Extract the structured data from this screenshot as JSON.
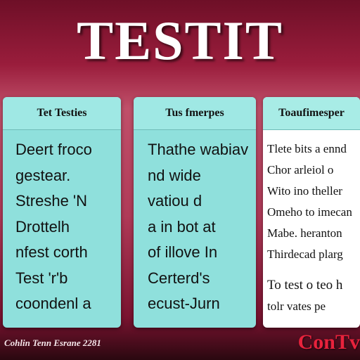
{
  "title": "TESTIT",
  "cards": [
    {
      "header": "Tet Testies",
      "lines": [
        "Deert froco",
        "gestear.",
        "Streshe 'N",
        "Drottelh",
        "nfest corth",
        "Test 'r'b",
        "coondenl a"
      ]
    },
    {
      "header": "Tus fmerpes",
      "lines": [
        "Thathe wabiave",
        "nd wide",
        "vatiou d",
        "a in bot  at",
        "of illove In",
        "Certerd's",
        "ecust-Jurn"
      ]
    },
    {
      "header": "Toaufimesper",
      "lines": [
        "Tlete bits a ennd",
        "Chor arleiol o",
        "Wito ino theller",
        "Omeho to imecan",
        "Mabe. heranton",
        "Thirdecad plarg",
        "To test o teo h",
        "tolr vates pe"
      ]
    }
  ],
  "footer": {
    "left": "Cohlin Tenn Esrane 2281",
    "right": "ConTv"
  }
}
